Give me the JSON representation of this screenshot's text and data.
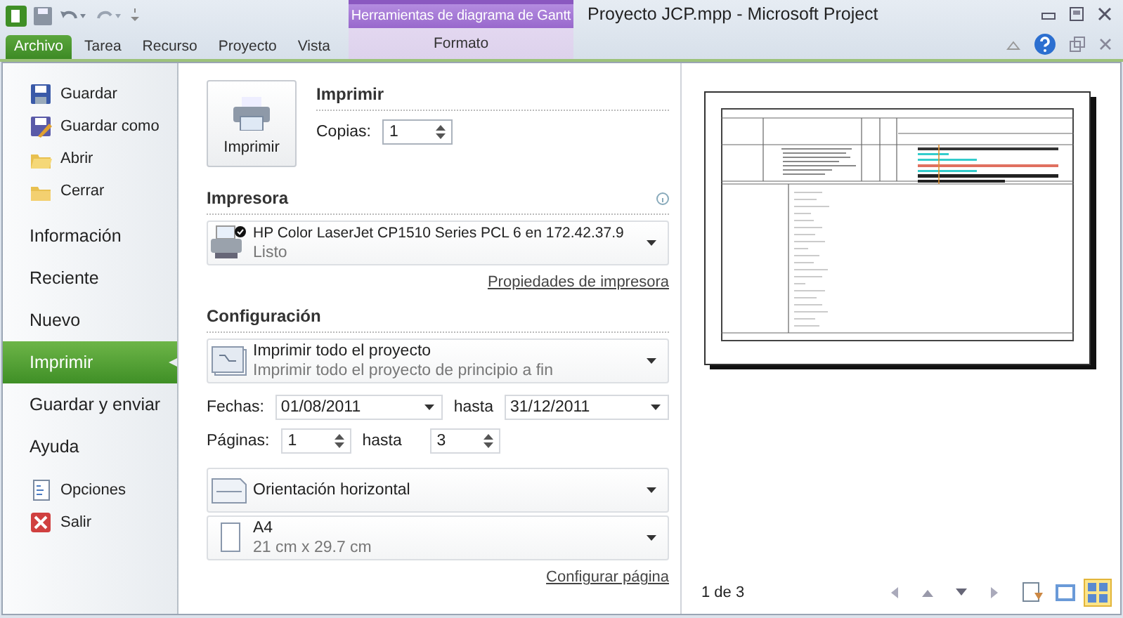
{
  "window": {
    "title": "Proyecto JCP.mpp - Microsoft Project"
  },
  "tabs": [
    {
      "label": "Archivo",
      "selected": true
    },
    {
      "label": "Tarea",
      "selected": false
    },
    {
      "label": "Recurso",
      "selected": false
    },
    {
      "label": "Proyecto",
      "selected": false
    },
    {
      "label": "Vista",
      "selected": false
    }
  ],
  "context_group": {
    "label": "Herramientas de diagrama de Gantt",
    "tabs": [
      {
        "label": "Formato",
        "selected": false
      }
    ]
  },
  "sidebar": {
    "items": [
      {
        "kind": "command",
        "label": "Guardar",
        "selected": false
      },
      {
        "kind": "command",
        "label": "Guardar como",
        "selected": false
      },
      {
        "kind": "command",
        "label": "Abrir",
        "selected": false
      },
      {
        "kind": "command",
        "label": "Cerrar",
        "selected": false
      },
      {
        "kind": "section",
        "label": "Información",
        "selected": false
      },
      {
        "kind": "section",
        "label": "Reciente",
        "selected": false
      },
      {
        "kind": "section",
        "label": "Nuevo",
        "selected": false
      },
      {
        "kind": "section",
        "label": "Imprimir",
        "selected": true
      },
      {
        "kind": "section",
        "label": "Guardar y enviar",
        "selected": false
      },
      {
        "kind": "section",
        "label": "Ayuda",
        "selected": false
      },
      {
        "kind": "command",
        "label": "Opciones",
        "selected": false
      },
      {
        "kind": "command",
        "label": "Salir",
        "selected": false
      }
    ]
  },
  "print": {
    "button": "Imprimir",
    "heading": "Imprimir",
    "copies_label": "Copias:",
    "copies": "1"
  },
  "printer": {
    "heading": "Impresora",
    "name": "HP Color LaserJet CP1510 Series PCL 6 en 172.42.37.9",
    "status": "Listo",
    "link": "Propiedades de impresora"
  },
  "settings": {
    "heading": "Configuración",
    "scope": {
      "title": "Imprimir todo el proyecto",
      "subtitle": "Imprimir todo el proyecto de principio a fin"
    },
    "dates": {
      "label": "Fechas:",
      "from": "01/08/2011",
      "to_label": "hasta",
      "to": "31/12/2011"
    },
    "pages": {
      "label": "Páginas:",
      "from": "1",
      "to_label": "hasta",
      "to": "3"
    },
    "orientation": {
      "title": "Orientación horizontal"
    },
    "paper": {
      "title": "A4",
      "subtitle": "21 cm x 29.7 cm"
    },
    "link": "Configurar página"
  },
  "preview": {
    "page_indicator": "1 de 3",
    "view_buttons": [
      {
        "selected": false
      },
      {
        "selected": false
      },
      {
        "selected": true
      }
    ]
  }
}
